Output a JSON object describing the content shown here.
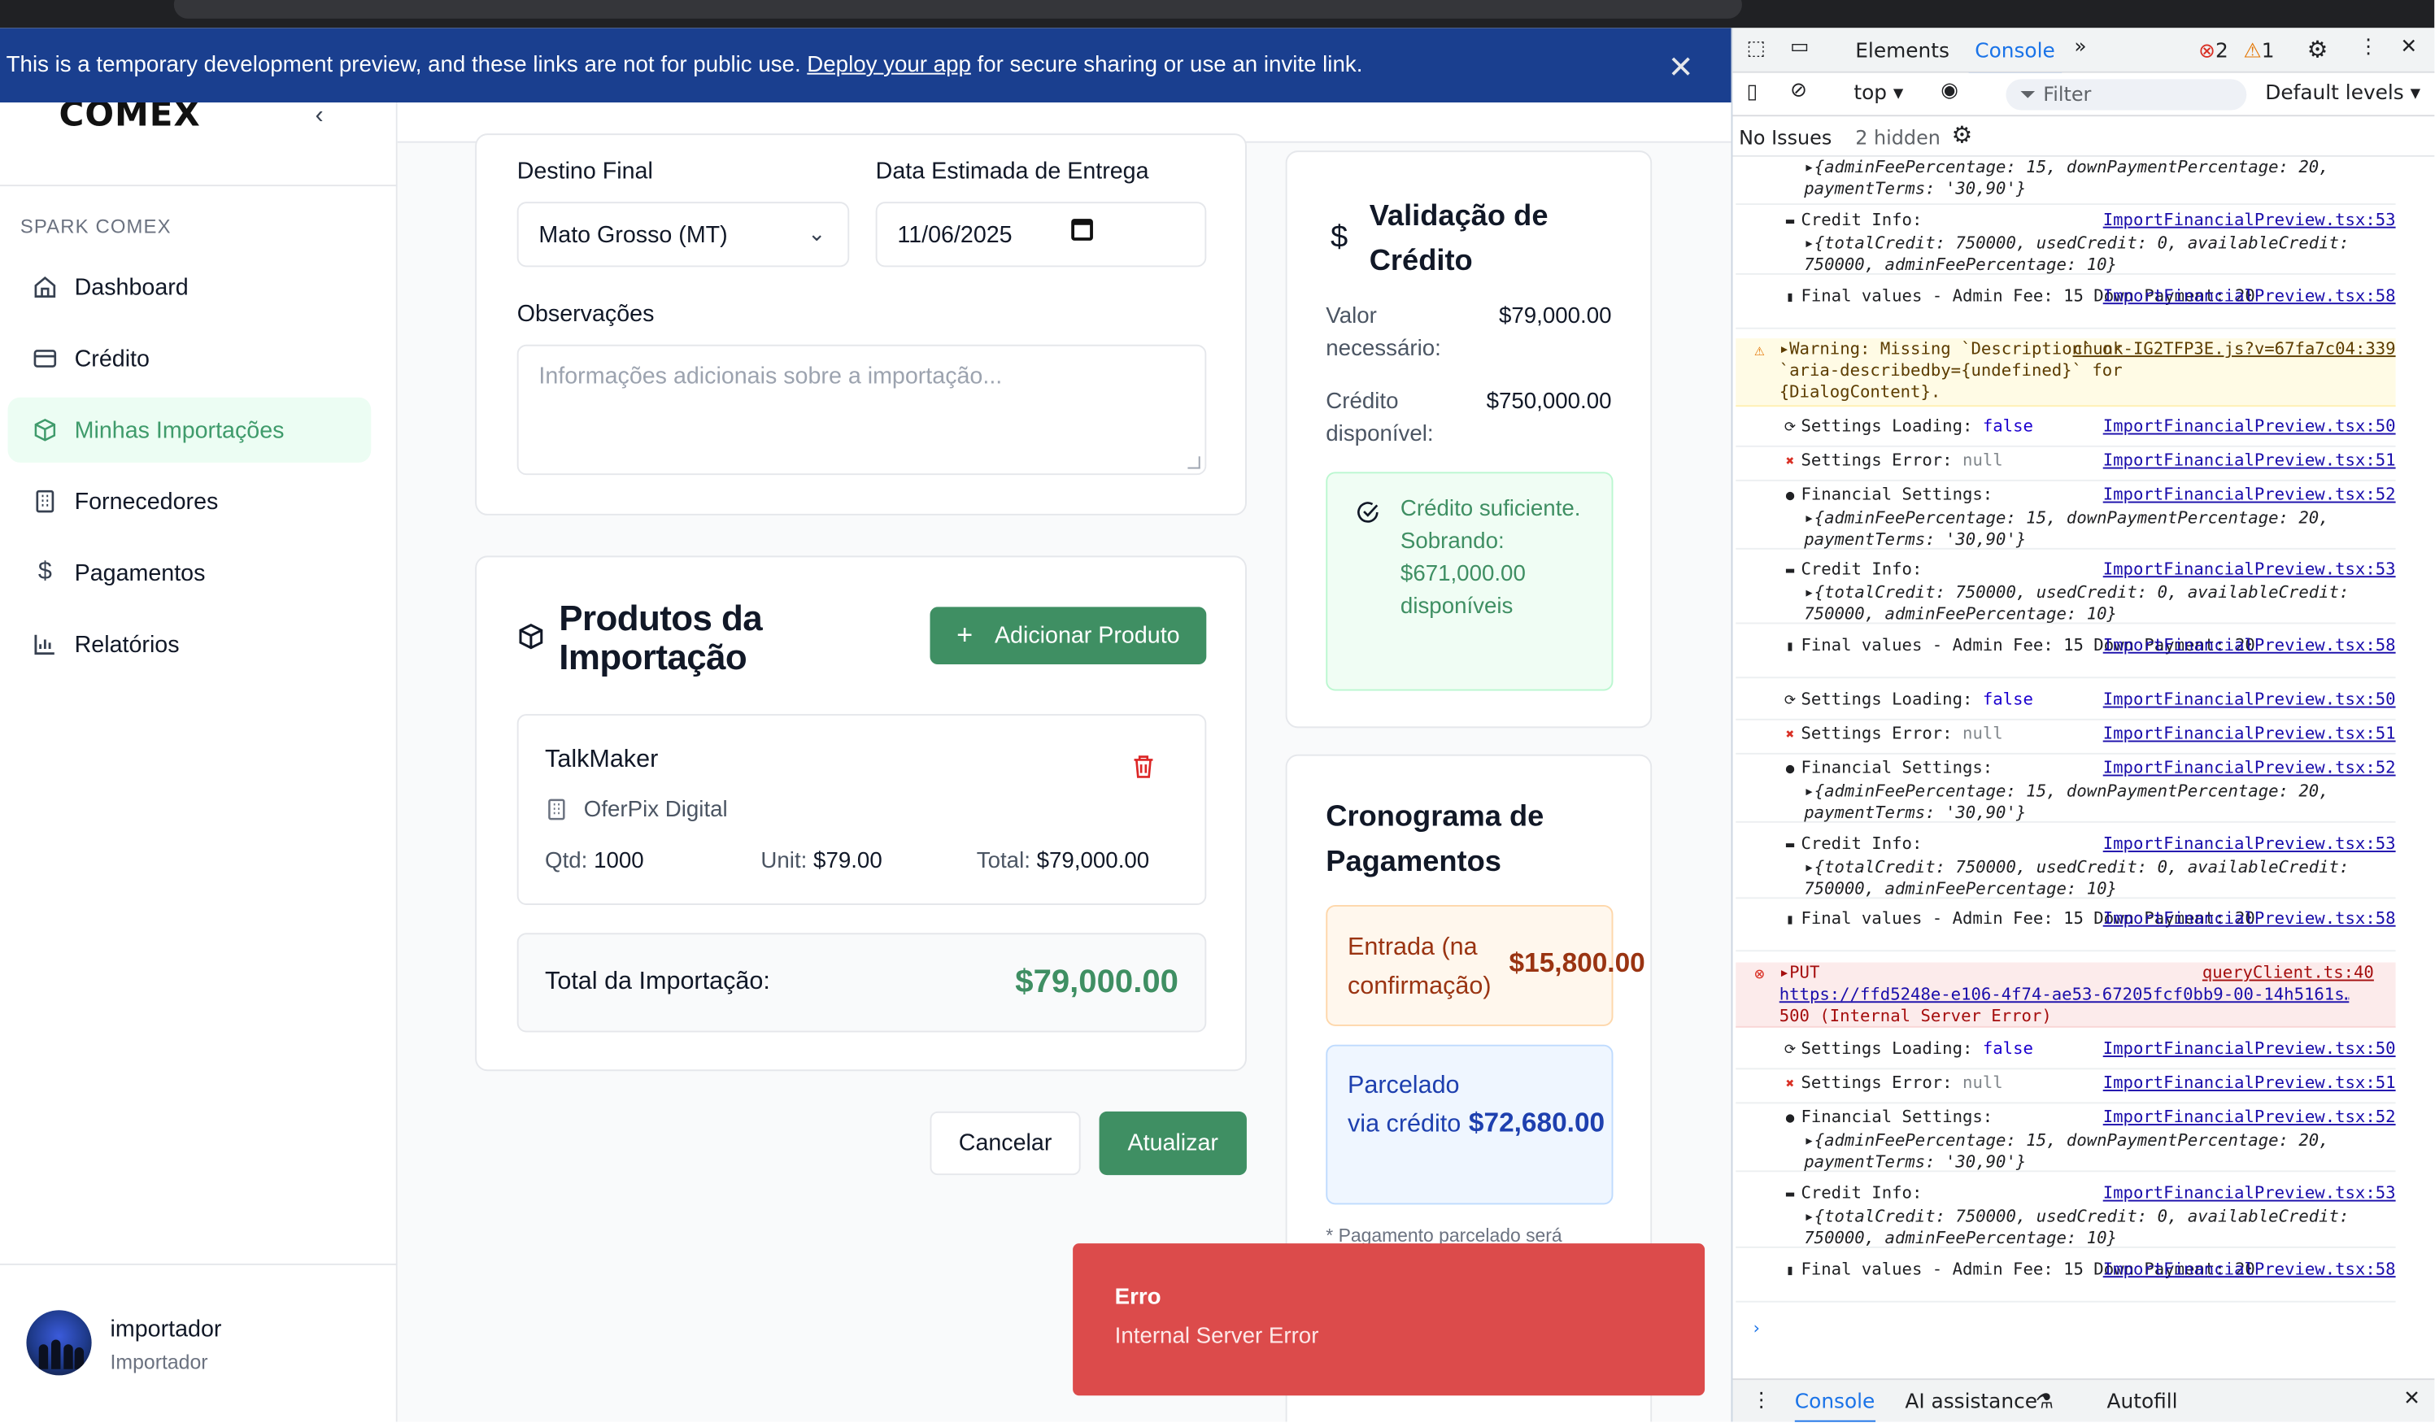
{
  "banner": {
    "text_before": "This is a temporary development preview, and these links are not for public use.",
    "link": "Deploy your app",
    "text_after": "for secure sharing or use an invite link."
  },
  "sidebar": {
    "logo": "COMEX",
    "section": "SPARK COMEX",
    "items": [
      {
        "label": "Dashboard",
        "icon": "home-icon"
      },
      {
        "label": "Crédito",
        "icon": "credit-card-icon"
      },
      {
        "label": "Minhas Importações",
        "icon": "package-icon",
        "active": true
      },
      {
        "label": "Fornecedores",
        "icon": "building-icon"
      },
      {
        "label": "Pagamentos",
        "icon": "dollar-icon"
      },
      {
        "label": "Relatórios",
        "icon": "bar-chart-icon"
      }
    ],
    "user": {
      "name": "importador",
      "role": "Importador"
    }
  },
  "form": {
    "destino_label": "Destino Final",
    "destino_value": "Mato Grosso (MT)",
    "data_label": "Data Estimada de Entrega",
    "data_value": "11/06/2025",
    "obs_label": "Observações",
    "obs_placeholder": "Informações adicionais sobre a importação..."
  },
  "products": {
    "title": "Produtos da Importação",
    "add_button": "Adicionar Produto",
    "items": [
      {
        "name": "TalkMaker",
        "supplier": "OferPix Digital",
        "qty_label": "Qtd:",
        "qty": "1000",
        "unit_label": "Unit:",
        "unit": "$79.00",
        "total_label": "Total:",
        "total": "$79,000.00"
      }
    ],
    "total_label": "Total da Importação:",
    "total_value": "$79,000.00"
  },
  "actions": {
    "cancel": "Cancelar",
    "update": "Atualizar"
  },
  "credit": {
    "title": "Validação de Crédito",
    "needed_label": "Valor necessário:",
    "needed_value": "$79,000.00",
    "available_label": "Crédito disponível:",
    "available_value": "$750,000.00",
    "ok_message": "Crédito suficiente. Sobrando: $671,000.00 disponíveis"
  },
  "schedule": {
    "title": "Cronograma de Pagamentos",
    "entrada_label": "Entrada (na confirmação)",
    "entrada_value": "$15,800.00",
    "parcelado_label": "Parcelado via crédito",
    "parcelado_value": "$72,680.00",
    "footnote": "* Pagamento parcelado será"
  },
  "toast": {
    "title": "Erro",
    "message": "Internal Server Error"
  },
  "devtools": {
    "tabs": [
      "Elements",
      "Console"
    ],
    "active_tab": "Console",
    "errors": "2",
    "warnings": "1",
    "context": "top",
    "filter_placeholder": "Filter",
    "levels": "Default levels",
    "no_issues": "No Issues",
    "hidden": "2 hidden",
    "bottom_tabs": [
      "Console",
      "AI assistance",
      "Autofill"
    ],
    "log_fin_tail": "{adminFeePercentage: 15, downPaymentPercentage: 20, paymentTerms: '30,90'}",
    "credit_info": "Credit Info:",
    "credit_obj": "{totalCredit: 750000, usedCredit: 0, availableCredit: 750000, adminFeePercentage: 10}",
    "final_values": "Final values - Admin Fee: 15 Down Payment: 20",
    "warning": "Warning: Missing `Description` or `aria-describedby={undefined}` for {DialogContent}.",
    "warning_src": "chunk-IG2TFP3E.js?v=67fa7c04:339",
    "settings_loading": "Settings Loading:",
    "settings_error": "Settings Error:",
    "financial_settings": "Financial Settings:",
    "put_label": "PUT",
    "put_url": "https://ffd5248e-e106-4f74-ae53-67205fcf0bb9-00-14h5161s…",
    "put_status": "500 (Internal Server Error)",
    "put_src": "queryClient.ts:40",
    "src50": "ImportFinancialPreview.tsx:50",
    "src51": "ImportFinancialPreview.tsx:51",
    "src52": "ImportFinancialPreview.tsx:52",
    "src53": "ImportFinancialPreview.tsx:53",
    "src58": "ImportFinancialPreview.tsx:58"
  }
}
